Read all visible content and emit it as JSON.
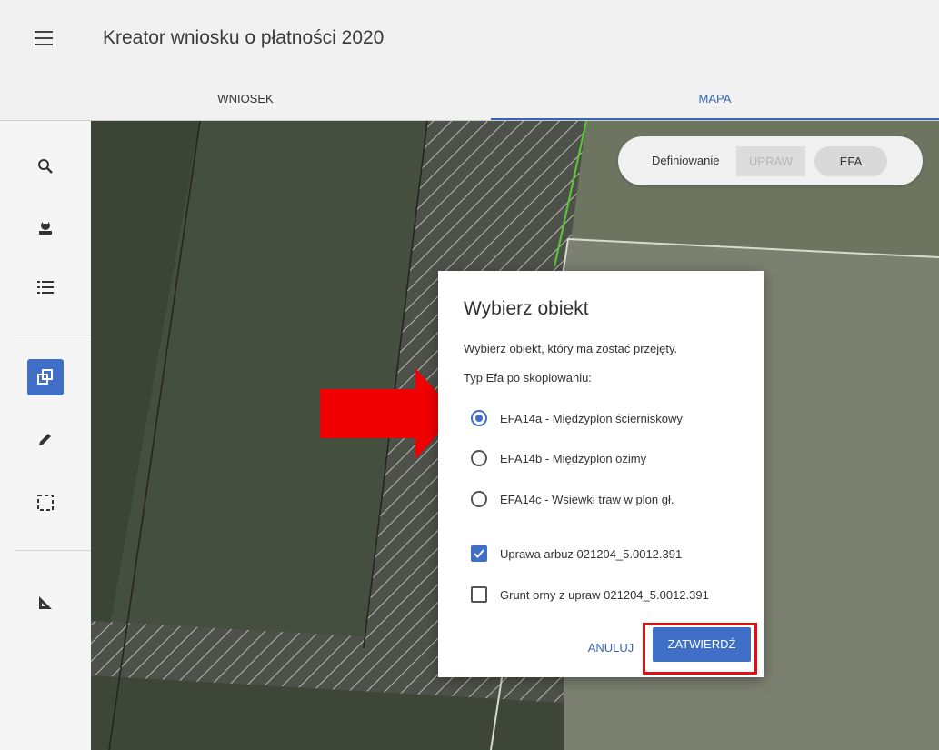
{
  "header": {
    "title": "Kreator wniosku o płatności 2020",
    "menu_icon": "hamburger-icon"
  },
  "tabs": [
    {
      "label": "WNIOSEK",
      "active": false
    },
    {
      "label": "MAPA",
      "active": true
    }
  ],
  "sidebar": {
    "tools": [
      {
        "name": "search-icon"
      },
      {
        "name": "crop-icon"
      },
      {
        "name": "list-icon"
      },
      {
        "name": "copy-icon",
        "active": true
      },
      {
        "name": "pencil-icon"
      },
      {
        "name": "select-area-icon"
      },
      {
        "name": "measure-icon"
      }
    ]
  },
  "mode_switch": {
    "label": "Definiowanie",
    "options": [
      "UPRAW",
      "EFA"
    ],
    "selected": "EFA"
  },
  "dialog": {
    "title": "Wybierz obiekt",
    "description": "Wybierz obiekt, który ma zostać przejęty.",
    "subtitle": "Typ Efa po skopiowaniu:",
    "radio_options": [
      {
        "label": "EFA14a - Międzyplon ścierniskowy",
        "selected": true
      },
      {
        "label": "EFA14b - Międzyplon ozimy",
        "selected": false
      },
      {
        "label": "EFA14c - Wsiewki traw w plon gł.",
        "selected": false
      }
    ],
    "checkbox_options": [
      {
        "label": "Uprawa arbuz 021204_5.0012.391",
        "checked": true
      },
      {
        "label": "Grunt orny z upraw 021204_5.0012.391",
        "checked": false
      }
    ],
    "cancel_label": "ANULUJ",
    "confirm_label": "ZATWIERDŹ"
  },
  "colors": {
    "accent": "#3f6fc7",
    "highlight": "#e01010"
  }
}
